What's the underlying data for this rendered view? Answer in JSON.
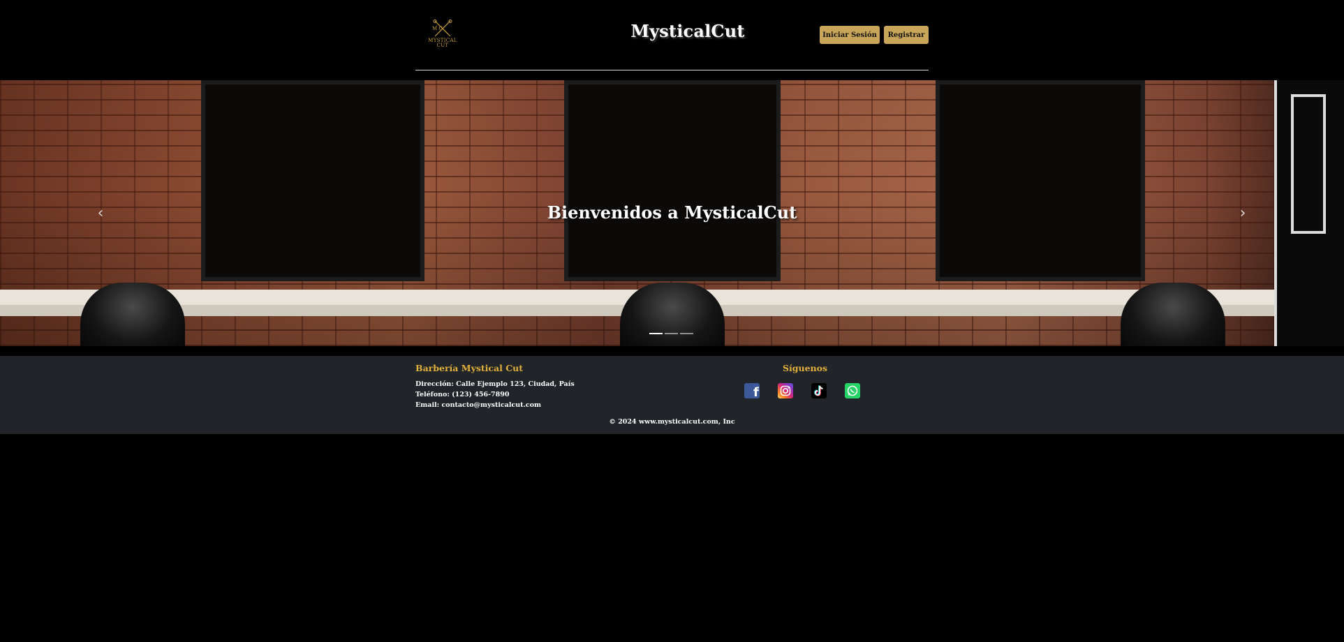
{
  "header": {
    "logo_monogram": "M  C",
    "logo_text_line1": "MYSTICAL",
    "logo_text_line2": "CUT",
    "title": "MysticalCut",
    "login_label": "Iniciar Sesión",
    "register_label": "Registrar"
  },
  "hero": {
    "title": "Bienvenidos a MysticalCut",
    "prev_icon": "chevron-left-icon",
    "next_icon": "chevron-right-icon",
    "slides_count": 3,
    "active_slide": 1
  },
  "footer": {
    "brand_heading": "Barbería Mystical Cut",
    "address": "Dirección: Calle Ejemplo 123, Ciudad, País",
    "phone": "Teléfono: (123) 456-7890",
    "email": "Email: contacto@mysticalcut.com",
    "follow_heading": "Síguenos",
    "social": [
      "facebook-icon",
      "instagram-icon",
      "tiktok-icon",
      "whatsapp-icon"
    ],
    "copyright": "© 2024 www.mysticalcut.com, Inc"
  },
  "colors": {
    "background": "#000000",
    "accent_gold": "#c9a55a",
    "footer_bg": "#212529",
    "footer_heading": "#e2b13c"
  }
}
